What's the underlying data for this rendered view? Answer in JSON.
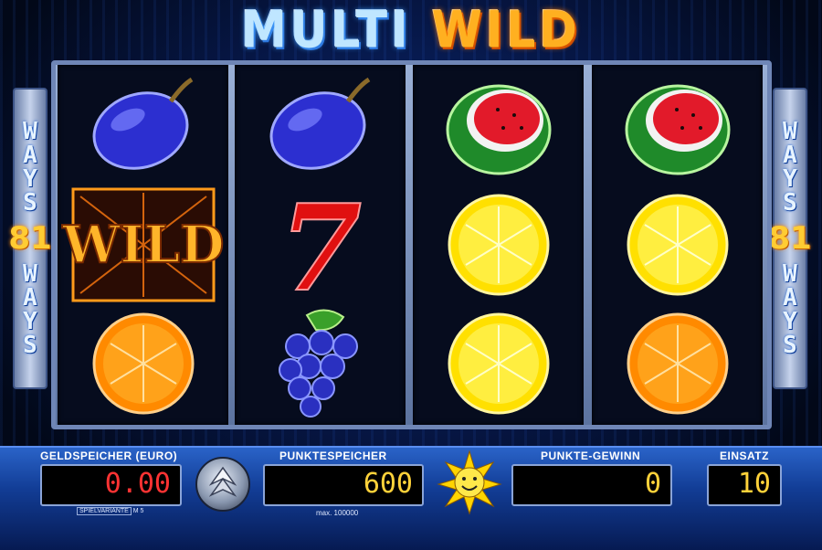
{
  "game": {
    "title_part1": "MULTI",
    "title_part2": "WILD"
  },
  "ways": {
    "left_top": [
      "W",
      "A",
      "Y",
      "S"
    ],
    "left_number": "81",
    "left_bottom": [
      "W",
      "A",
      "Y",
      "S"
    ],
    "right_top": [
      "W",
      "A",
      "Y",
      "S"
    ],
    "right_number": "81",
    "right_bottom": [
      "W",
      "A",
      "Y",
      "S"
    ]
  },
  "reels": [
    {
      "symbols": [
        "plum-icon",
        "wild-icon",
        "orange-icon"
      ]
    },
    {
      "symbols": [
        "plum-icon",
        "seven-icon",
        "grapes-icon"
      ]
    },
    {
      "symbols": [
        "watermelon-icon",
        "lemon-icon",
        "lemon-icon"
      ]
    },
    {
      "symbols": [
        "watermelon-icon",
        "lemon-icon",
        "orange-icon"
      ]
    }
  ],
  "wild_symbol_text": "WILD",
  "seven_symbol_text": "7",
  "panel": {
    "credit_label": "GELDSPEICHER (EURO)",
    "credit_value": "0.00",
    "variant_label": "SPIELVARIANTE",
    "variant_code": "M 5",
    "points_label": "PUNKTESPEICHER",
    "points_value": "600",
    "max_label": "max. 100000",
    "win_label": "PUNKTE-GEWINN",
    "win_value": "0",
    "bet_label": "EINSATZ",
    "bet_value": "10"
  },
  "colors": {
    "title_blue": "#bfe6ff",
    "title_orange": "#ffb020",
    "credit_red": "#ff3333",
    "digits_yellow": "#ffd23a",
    "ways_number": "#ffcc33"
  }
}
